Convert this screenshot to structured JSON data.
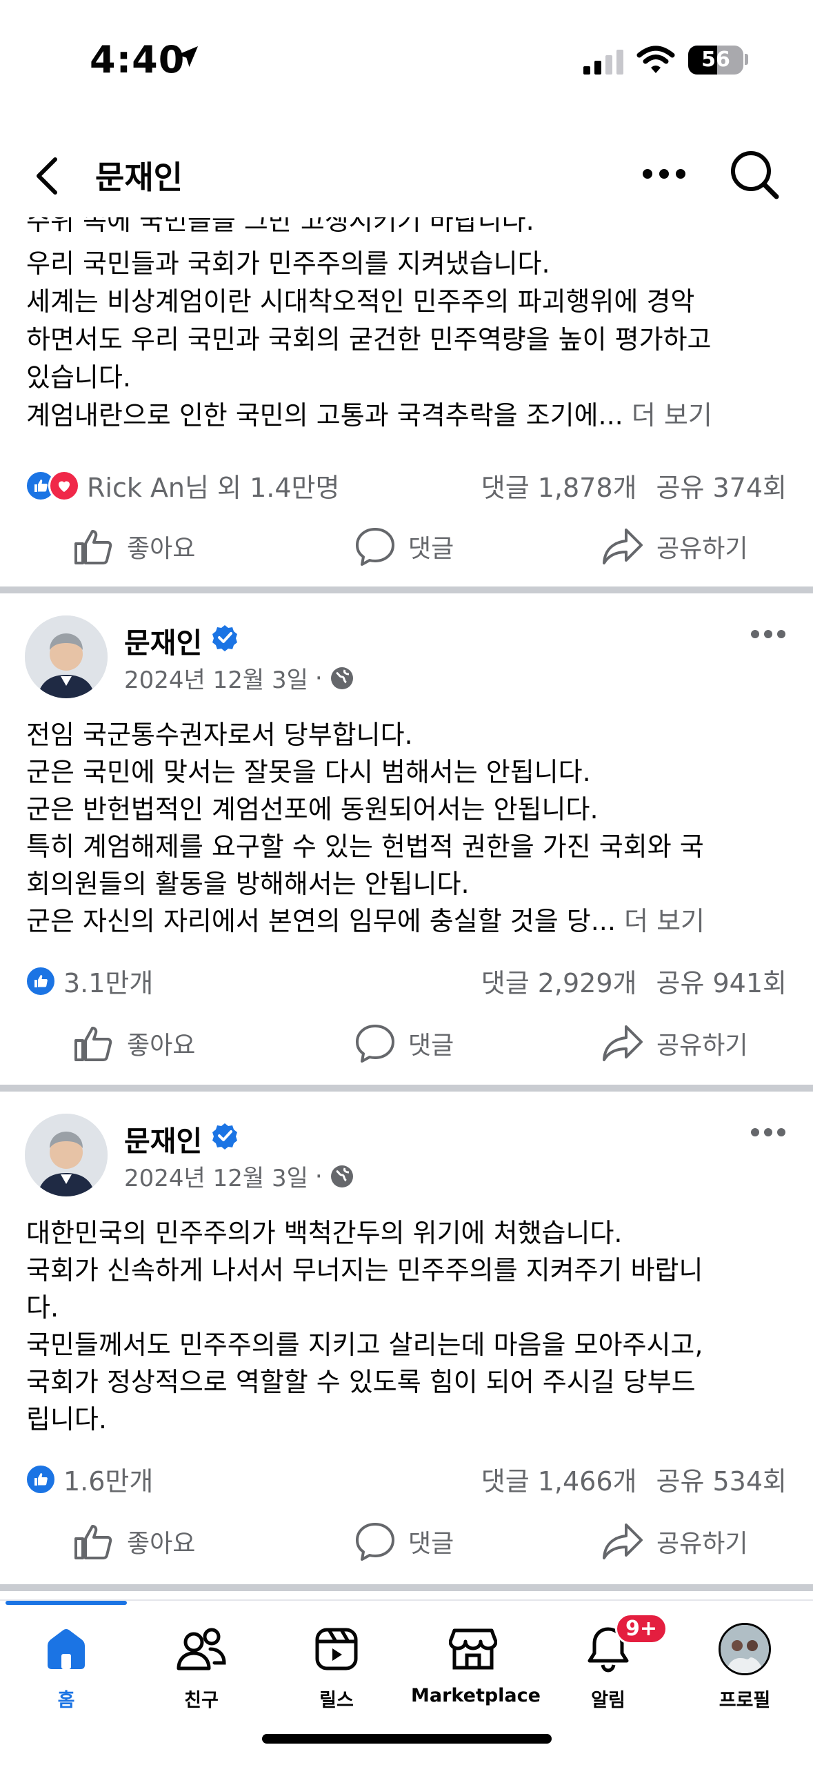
{
  "status_bar": {
    "time": "4:40",
    "battery": "56"
  },
  "nav": {
    "title": "문재인"
  },
  "top_post": {
    "cut_line": "주위 속에 국민들을 그만 고생시키기 바랍니다.",
    "lines": [
      "우리 국민들과 국회가 민주주의를 지켜냈습니다.",
      "세계는 비상계엄이란 시대착오적인 민주주의 파괴행위에 경악",
      "하면서도 우리 국민과 국회의 굳건한 민주역량을 높이 평가하고",
      "있습니다."
    ],
    "last_line": "계엄내란으로 인한 국민의 고통과 국격추락을 조기에...",
    "see_more": "더 보기",
    "reactions_text": "Rick An님 외 1.4만명",
    "comments": "댓글 1,878개",
    "shares": "공유 374회"
  },
  "posts": [
    {
      "author": "문재인",
      "date": "2024년 12월 3일",
      "lines": [
        "전임 국군통수권자로서 당부합니다.",
        "군은 국민에 맞서는 잘못을 다시 범해서는 안됩니다.",
        "군은 반헌법적인 계엄선포에 동원되어서는 안됩니다.",
        "특히 계엄해제를 요구할 수 있는 헌법적 권한을 가진 국회와 국",
        "회의원들의 활동을 방해해서는 안됩니다."
      ],
      "last_line": "군은 자신의 자리에서 본연의 임무에 충실할 것을 당...",
      "see_more": "더 보기",
      "likes": "3.1만개",
      "comments": "댓글 2,929개",
      "shares": "공유 941회"
    },
    {
      "author": "문재인",
      "date": "2024년 12월 3일",
      "lines": [
        "대한민국의 민주주의가 백척간두의 위기에 처했습니다.",
        "국회가 신속하게 나서서 무너지는 민주주의를 지켜주기 바랍니",
        "다.",
        "국민들께서도 민주주의를 지키고 살리는데 마음을 모아주시고,",
        "국회가 정상적으로 역할할 수 있도록 힘이 되어 주시길 당부드",
        "립니다."
      ],
      "likes": "1.6만개",
      "comments": "댓글 1,466개",
      "shares": "공유 534회"
    }
  ],
  "actions": {
    "like": "좋아요",
    "comment": "댓글",
    "share": "공유하기"
  },
  "tabs": {
    "home": "홈",
    "friends": "친구",
    "reels": "릴스",
    "marketplace": "Marketplace",
    "notifications": "알림",
    "notifications_badge": "9+",
    "profile": "프로필"
  },
  "icons": {
    "nav": [
      "chevron-left-icon",
      "more-horizontal-icon",
      "search-icon"
    ],
    "actions": [
      "thumbs-up-icon",
      "comment-bubble-icon",
      "share-arrow-icon"
    ],
    "tabs": [
      "home-icon",
      "friends-icon",
      "reels-icon",
      "marketplace-store-icon",
      "bell-icon",
      "profile-avatar"
    ]
  },
  "colors": {
    "accent": "#1b74e4",
    "love": "#f02849",
    "badge": "#e41e3f",
    "muted_text": "#65676b",
    "separator": "#c9ccd1"
  }
}
